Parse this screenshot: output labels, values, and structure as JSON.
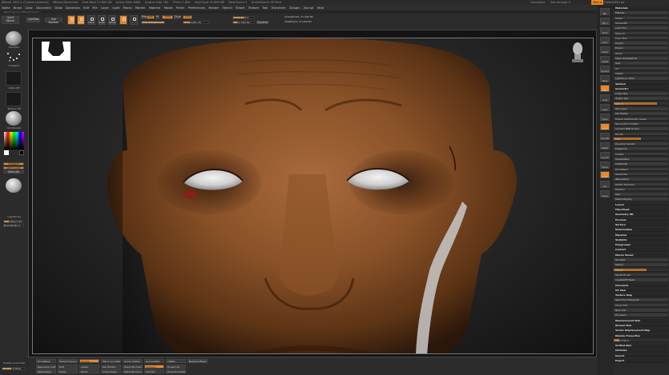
{
  "title_bar": {
    "left": [
      "ZBrush 2021.1.2 [anne.carlmore]",
      "ZBrush Document",
      "Free Mem 27.881 GB",
      "Active Mem 4682",
      "Scratch Disk 762",
      "ZTime 1.890",
      "PolyCount 41.899 MP",
      "MeshCount 1",
      "QuickSave In 39 Secs"
    ],
    "right": [
      "QuickSave",
      "See-through 0",
      "Menus",
      "DefaultZScript"
    ]
  },
  "menu_bar": [
    "Alpha",
    "Brush",
    "Color",
    "Document",
    "Draw",
    "Dynamics",
    "Edit",
    "File",
    "Layer",
    "Light",
    "Macro",
    "Marker",
    "Material",
    "Movie",
    "Picker",
    "Preferences",
    "Render",
    "Stencil",
    "Stroke",
    "Texture",
    "Tool",
    "Transform",
    "Zplugin",
    "Zscript",
    "Help"
  ],
  "status_line": "Switching to a different brush...",
  "top_shelf": {
    "lightbox": "LightBox",
    "live_boolean": "Live Boolean",
    "quick_sketch": "Quick Sketch",
    "modes": [
      "Edit",
      "Draw",
      "Move",
      "Scale",
      "Rotate"
    ],
    "mrgb": "Mrgb",
    "rgb": "Rgb",
    "m": "M",
    "zadd": "Zadd",
    "zsub": "Zsub",
    "zcut": "Zcut",
    "rgb_intensity": "Rgb Intensity 100",
    "z_intensity": "Z Intensity 25",
    "focal_shift": "Focal Shift 0",
    "draw_size": "Draw Size 64",
    "dynamic": "Dynamic",
    "active_points": "ActivePoints: 27.290 Mil",
    "total_points": "TotalPoints: 27.290 Mil"
  },
  "left_tray": {
    "labels": [
      "Standard",
      "DragRect",
      "Alpha Off",
      "Texture Off",
      "SkinShade4",
      "Gradient",
      "SwitchColor",
      "Alternate",
      "LazyMouse",
      "LazyStep 0.25",
      "LazyRadius 1"
    ]
  },
  "right_tools": [
    "Bpr",
    "SPix 3",
    "Scroll",
    "Zoom",
    "Actual",
    "AAHalf",
    "Dynamic",
    "Persp",
    "Floor",
    "Local",
    "L.Sym",
    "Frame",
    "Move",
    "Zoom3D",
    "Rotate",
    "Line Fill",
    "Transp",
    "Ghost",
    "Solo",
    "Xpose"
  ],
  "right_panel": {
    "items": [
      {
        "t": "Materials",
        "k": "hdr"
      },
      {
        "t": "MatCap",
        "k": "btn"
      },
      {
        "t": "Select",
        "k": "btn"
      },
      {
        "t": "Sphere3D",
        "k": "btn"
      },
      {
        "t": "Load Tool",
        "k": "btn"
      },
      {
        "t": "Save As",
        "k": "btn"
      },
      {
        "t": "Copy Tool",
        "k": "btn"
      },
      {
        "t": "Import",
        "k": "btn"
      },
      {
        "t": "Export",
        "k": "btn"
      },
      {
        "t": "Clone",
        "k": "btn"
      },
      {
        "t": "Make PolyMesh3D",
        "k": "btn"
      },
      {
        "t": "GoZ",
        "k": "btn"
      },
      {
        "t": "All",
        "k": "btn"
      },
      {
        "t": "Visible",
        "k": "btn"
      },
      {
        "t": "Lightbox ▸ Tools",
        "k": "btn"
      },
      {
        "t": "Subtool",
        "k": "hdr"
      },
      {
        "t": "Geometry",
        "k": "hdr"
      },
      {
        "t": "Lower Res",
        "k": "btn"
      },
      {
        "t": "Higher Res",
        "k": "btn"
      },
      {
        "t": "SDiv 6",
        "k": "bar",
        "v": 0.8
      },
      {
        "t": "Del Lower",
        "k": "btn"
      },
      {
        "t": "Del Higher",
        "k": "btn"
      },
      {
        "t": "Freeze SubDivision Levels",
        "k": "btn"
      },
      {
        "t": "Reconstruct Subdiv",
        "k": "btn"
      },
      {
        "t": "Convert BPR To Geo",
        "k": "btn"
      },
      {
        "t": "Divide",
        "k": "btn"
      },
      {
        "t": "Smt",
        "k": "bar",
        "v": 0.5
      },
      {
        "t": "Dynamic Subdiv",
        "k": "btn"
      },
      {
        "t": "EdgeLoop",
        "k": "btn"
      },
      {
        "t": "Crease",
        "k": "btn"
      },
      {
        "t": "ShadowBox",
        "k": "btn"
      },
      {
        "t": "ClayPolish",
        "k": "btn"
      },
      {
        "t": "DynaMesh",
        "k": "btn"
      },
      {
        "t": "Tessimate",
        "k": "btn"
      },
      {
        "t": "ZRemesher",
        "k": "btn"
      },
      {
        "t": "Modify Topology",
        "k": "btn"
      },
      {
        "t": "Position",
        "k": "btn"
      },
      {
        "t": "Size",
        "k": "btn"
      },
      {
        "t": "MeshIntegrity",
        "k": "btn"
      },
      {
        "t": "Layers",
        "k": "hdr"
      },
      {
        "t": "FiberMesh",
        "k": "hdr"
      },
      {
        "t": "Geometry HD",
        "k": "hdr"
      },
      {
        "t": "Preview",
        "k": "hdr"
      },
      {
        "t": "Surface",
        "k": "hdr"
      },
      {
        "t": "Deformation",
        "k": "hdr"
      },
      {
        "t": "Masking",
        "k": "hdr"
      },
      {
        "t": "Visibility",
        "k": "hdr"
      },
      {
        "t": "Polygroups",
        "k": "hdr"
      },
      {
        "t": "Contact",
        "k": "hdr"
      },
      {
        "t": "Morph Target",
        "k": "hdr"
      },
      {
        "t": "StoreMT",
        "k": "btn"
      },
      {
        "t": "Switch",
        "k": "btn"
      },
      {
        "t": "Morph",
        "k": "bar",
        "v": 0.6
      },
      {
        "t": "Morph Brush",
        "k": "btn"
      },
      {
        "t": "CreateDiff Mesh",
        "k": "btn"
      },
      {
        "t": "Polypaint",
        "k": "hdr"
      },
      {
        "t": "UV Map",
        "k": "hdr"
      },
      {
        "t": "Texture Map",
        "k": "hdr"
      },
      {
        "t": "New From Polypaint",
        "k": "btn"
      },
      {
        "t": "Clone Txtr",
        "k": "btn"
      },
      {
        "t": "New Txtr",
        "k": "btn"
      },
      {
        "t": "Fix Seam",
        "k": "btn"
      },
      {
        "t": "Displacement Map",
        "k": "hdr"
      },
      {
        "t": "Normal Map",
        "k": "hdr"
      },
      {
        "t": "Vector Displacement Map",
        "k": "hdr"
      },
      {
        "t": "Display Properties",
        "k": "hdr"
      },
      {
        "t": "DSmooth 0",
        "k": "bar",
        "v": 0.1
      },
      {
        "t": "Unified Skin",
        "k": "hdr"
      },
      {
        "t": "Initialize",
        "k": "hdr"
      },
      {
        "t": "Import",
        "k": "hdr"
      },
      {
        "t": "Export",
        "k": "hdr"
      }
    ]
  },
  "bottom_bar": {
    "items": [
      "Enable Customize",
      "Backface Mask",
      "DynaMesh",
      "Resolution 128",
      "ZRemesher",
      "Target Polygons Count 5",
      "Half",
      "Same",
      "Double",
      "Adapt",
      "Mirror",
      "Mirror And Weld",
      "Del Hidden",
      "Close Holes",
      "Group Visible",
      "Polish By Features",
      "Polish By Groups",
      "GroupsSplit",
      "Sharpen",
      "Smooth",
      "Inflate",
      "Project All",
      "ProjectionShell",
      "BackfaceMask"
    ]
  }
}
